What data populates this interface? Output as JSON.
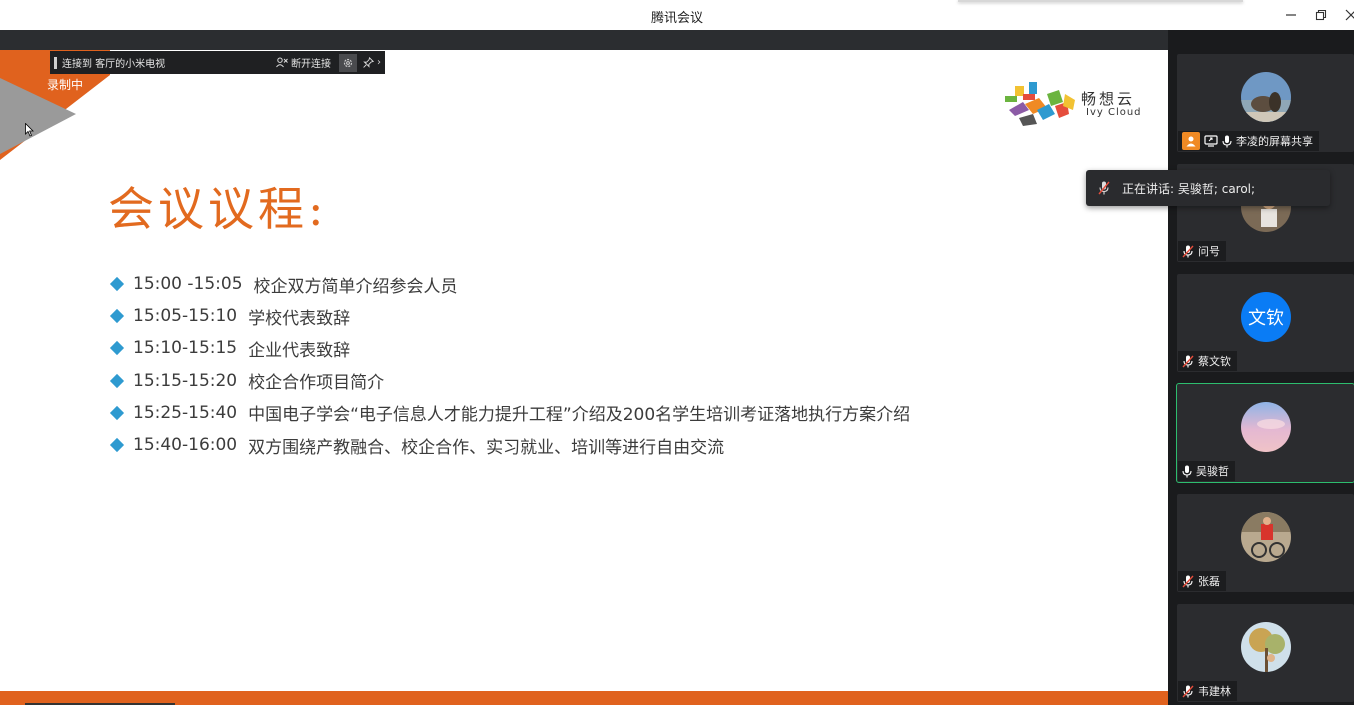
{
  "window": {
    "title": "腾讯会议",
    "minimize_icon": "minimize-icon",
    "maximize_icon": "restore-icon",
    "close_icon": "close-icon"
  },
  "share_bar": {
    "connection_text": "连接到 客厅的小米电视",
    "disconnect_label": "断开连接"
  },
  "recording": {
    "label": "录制中"
  },
  "slide": {
    "logo_cn": "畅想云",
    "logo_en": "Ivy Cloud",
    "title": "会议议程:",
    "items": [
      {
        "time": "15:00 -15:05",
        "text": "校企双方简单介绍参会人员"
      },
      {
        "time": "15:05-15:10",
        "text": "学校代表致辞"
      },
      {
        "time": "15:10-15:15",
        "text": "企业代表致辞"
      },
      {
        "time": "15:15-15:20",
        "text": "校企合作项目简介"
      },
      {
        "time": "15:25-15:40",
        "text": "中国电子学会“电子信息人才能力提升工程”介绍及200名学生培训考证落地执行方案介绍"
      },
      {
        "time": "15:40-16:00",
        "text": "双方围绕产教融合、校企合作、实习就业、培训等进行自由交流"
      }
    ],
    "colors": {
      "title": "#e26a1f",
      "bullet": "#2e9ad0",
      "accent": "#e0621e"
    }
  },
  "speaking": {
    "text": "正在讲话: 吴骏哲; carol;"
  },
  "participants": [
    {
      "name": "李凌的屏幕共享",
      "mic": "on",
      "host": true,
      "screen_share": true,
      "avatar": "photo"
    },
    {
      "name": "问号",
      "mic": "muted",
      "avatar": "photo"
    },
    {
      "name": "蔡文钦",
      "mic": "muted",
      "avatar_text": "文钦"
    },
    {
      "name": "吴骏哲",
      "mic": "on",
      "active": true,
      "avatar": "photo"
    },
    {
      "name": "张磊",
      "mic": "muted",
      "avatar": "photo"
    },
    {
      "name": "韦建林",
      "mic": "muted",
      "avatar": "photo"
    }
  ]
}
